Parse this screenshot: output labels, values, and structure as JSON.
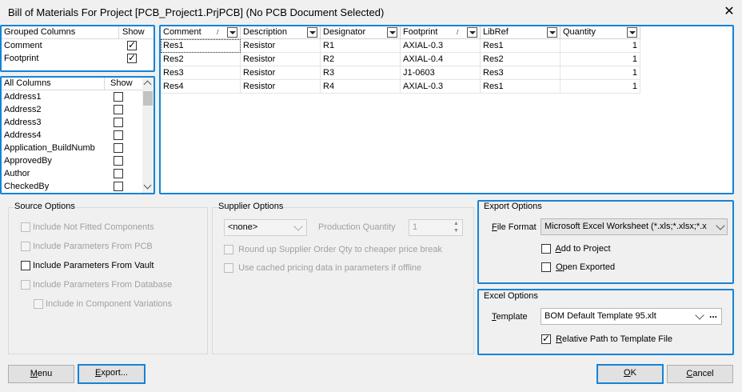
{
  "window": {
    "title": "Bill of Materials For Project [PCB_Project1.PrjPCB] (No PCB Document Selected)"
  },
  "grouped_columns": {
    "header": "Grouped Columns",
    "show_header": "Show",
    "items": [
      {
        "label": "Comment",
        "checked": true
      },
      {
        "label": "Footprint",
        "checked": true
      }
    ]
  },
  "all_columns": {
    "header": "All Columns",
    "show_header": "Show",
    "items": [
      {
        "label": "Address1",
        "checked": false
      },
      {
        "label": "Address2",
        "checked": false
      },
      {
        "label": "Address3",
        "checked": false
      },
      {
        "label": "Address4",
        "checked": false
      },
      {
        "label": "Application_BuildNumb",
        "checked": false
      },
      {
        "label": "ApprovedBy",
        "checked": false
      },
      {
        "label": "Author",
        "checked": false
      },
      {
        "label": "CheckedBy",
        "checked": false
      }
    ]
  },
  "grid": {
    "columns": [
      "Comment",
      "Description",
      "Designator",
      "Footprint",
      "LibRef",
      "Quantity"
    ],
    "rows": [
      [
        "Res1",
        "Resistor",
        "R1",
        "AXIAL-0.3",
        "Res1",
        "1"
      ],
      [
        "Res2",
        "Resistor",
        "R2",
        "AXIAL-0.4",
        "Res2",
        "1"
      ],
      [
        "Res3",
        "Resistor",
        "R3",
        "J1-0603",
        "Res3",
        "1"
      ],
      [
        "Res4",
        "Resistor",
        "R4",
        "AXIAL-0.3",
        "Res1",
        "1"
      ]
    ]
  },
  "source_options": {
    "title": "Source Options",
    "options": [
      {
        "label": "Include Not Fitted Components",
        "checked": false,
        "enabled": false
      },
      {
        "label": "Include Parameters From PCB",
        "checked": false,
        "enabled": false
      },
      {
        "label": "Include Parameters From Vault",
        "checked": false,
        "enabled": true
      },
      {
        "label": "Include Parameters From Database",
        "checked": false,
        "enabled": false
      },
      {
        "label": "Include in Component Variations",
        "checked": false,
        "enabled": false
      }
    ]
  },
  "supplier_options": {
    "title": "Supplier Options",
    "supplier_value": "<none>",
    "quantity_label": "Production Quantity",
    "quantity_value": "1",
    "round_up_label": "Round up Supplier Order Qty to cheaper price break",
    "cached_label": "Use cached pricing data in parameters if offline"
  },
  "export_options": {
    "title": "Export Options",
    "format_label_u": "F",
    "format_label_rest": "ile Format",
    "format_value": "Microsoft Excel Worksheet (*.xls;*.xlsx;*.x",
    "add_to_project_u": "A",
    "add_to_project_rest": "dd to Project",
    "open_exported_u": "O",
    "open_exported_rest": "pen Exported"
  },
  "excel_options": {
    "title": "Excel Options",
    "template_label_u": "T",
    "template_label_rest": "emplate",
    "template_value": "BOM Default Template 95.xlt",
    "browse_label": "...",
    "relative_path_u": "R",
    "relative_path_rest": "elative Path to Template File"
  },
  "buttons": {
    "menu_u": "M",
    "menu_rest": "enu",
    "export_u": "E",
    "export_rest": "xport...",
    "ok_u": "O",
    "ok_rest": "K",
    "cancel_u": "C",
    "cancel_rest": "ancel"
  },
  "colors": {
    "accent": "#1683d8",
    "disabled_text": "#a0a0a0"
  }
}
